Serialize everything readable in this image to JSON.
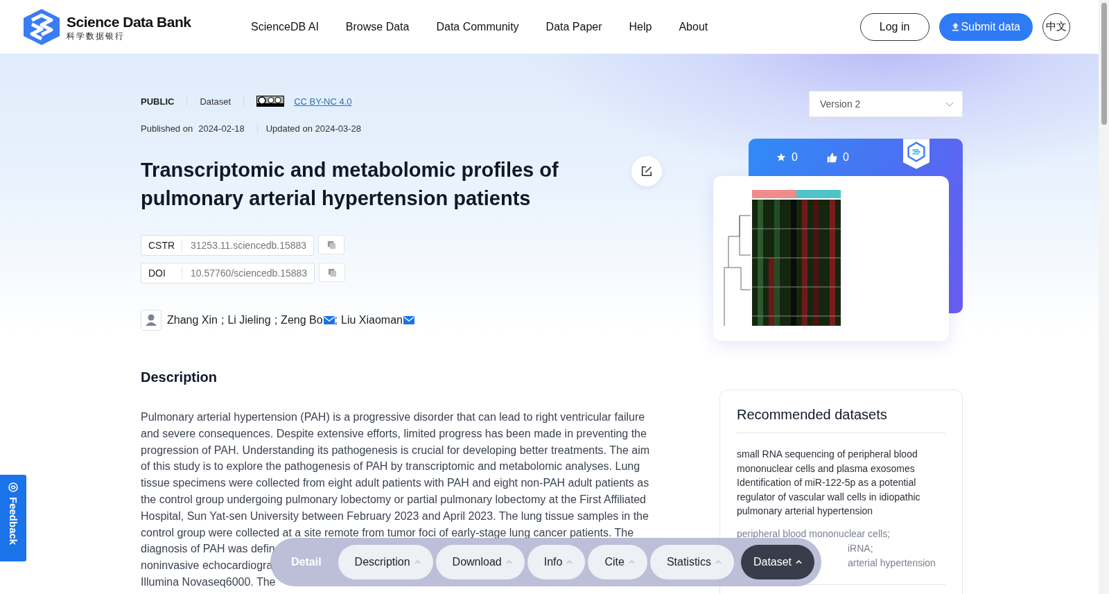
{
  "header": {
    "logo": {
      "name": "Science Data Bank",
      "subtitle": "科学数据银行"
    },
    "nav": [
      "ScienceDB AI",
      "Browse Data",
      "Data Community",
      "Data Paper",
      "Help",
      "About"
    ],
    "login": "Log in",
    "submit": "Submit data",
    "language": "中文"
  },
  "meta": {
    "access": "PUBLIC",
    "type": "Dataset",
    "license": "CC BY-NC 4.0",
    "published_label": "Published on",
    "published": "2024-02-18",
    "updated": "Updated on 2024-03-28"
  },
  "title": "Transcriptomic and metabolomic profiles of pulmonary arterial hypertension patients",
  "identifiers": [
    {
      "label": "CSTR",
      "value": "31253.11.sciencedb.15883"
    },
    {
      "label": "DOI",
      "value": "10.57760/sciencedb.15883"
    }
  ],
  "authors": [
    {
      "name": "Zhang Xin",
      "email": false,
      "sep": ";"
    },
    {
      "name": "Li Jieling",
      "email": false,
      "sep": ";"
    },
    {
      "name": "Zeng Bo",
      "email": true,
      "sep": ";"
    },
    {
      "name": "Liu Xiaoman",
      "email": true
    }
  ],
  "description": {
    "heading": "Description",
    "lines": [
      "Pulmonary arterial hypertension (PAH) is a progressive disorder that can lead to right ventricular failure",
      "and severe consequences. Despite extensive efforts, limited progress has been made in preventing the",
      "progression of PAH. Understanding its pathogenesis is crucial for developing better treatments. The aim",
      "of this study is to explore the pathogenesis of PAH by transcriptomic and metabolomic analyses. Lung",
      "tissue specimens were collected from eight adult patients with PAH and eight non-PAH adult patients as",
      "the control group undergoing pulmonary lobectomy or partial pulmonary lobectomy at the First Affiliated",
      "Hospital, Sun Yat-sen University between February 2023 and April 2023. The lung tissue samples in the",
      "control group were collected at a site remote from tumor foci of early-stage lung cancer patients. The",
      "diagnosis of PAH was defin",
      "noninvasive echocardiogra",
      "Illumina Novaseq6000. The"
    ]
  },
  "version_select": {
    "value": "Version 2"
  },
  "stats": {
    "stars": "0",
    "likes": "0"
  },
  "recommended": {
    "heading": "Recommended datasets",
    "items": [
      {
        "title": "small RNA sequencing of peripheral blood mononuclear cells and plasma exosomes Identification of miR-122-5p as a potential regulator of vascular wall cells in idiopathic pulmonary arterial hypertension",
        "keywords": [
          "peripheral blood mononuclear cells;",
          "iRNA;",
          "arterial hypertension"
        ]
      }
    ]
  },
  "section_bar": {
    "label": "Detail",
    "tabs": [
      {
        "label": "Description",
        "selected": false
      },
      {
        "label": "Download",
        "selected": false
      },
      {
        "label": "Info",
        "selected": false
      },
      {
        "label": "Cite",
        "selected": false
      },
      {
        "label": "Statistics",
        "selected": false
      },
      {
        "label": "Dataset",
        "selected": true
      }
    ]
  },
  "feedback": "Feedback"
}
